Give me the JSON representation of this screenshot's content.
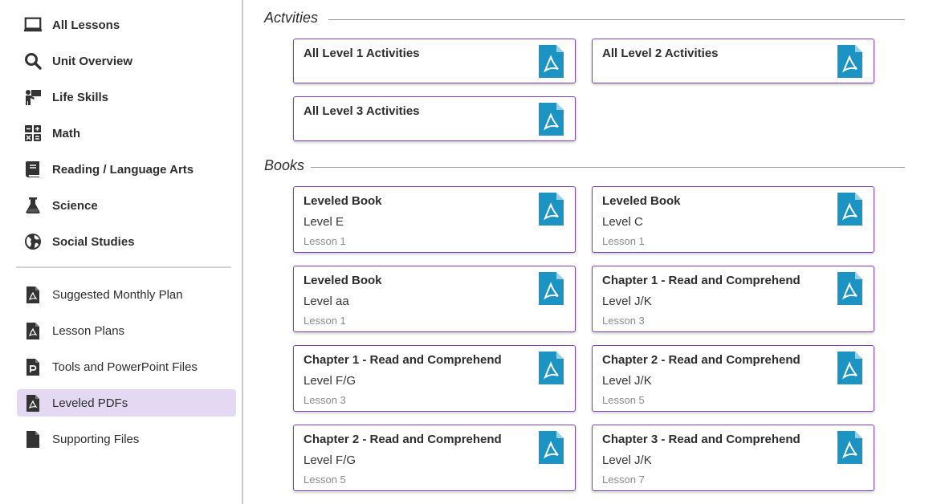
{
  "sidebar": {
    "items": [
      {
        "label": "All Lessons"
      },
      {
        "label": "Unit Overview"
      },
      {
        "label": "Life Skills"
      },
      {
        "label": "Math"
      },
      {
        "label": "Reading / Language Arts"
      },
      {
        "label": "Science"
      },
      {
        "label": "Social Studies"
      }
    ],
    "resources": [
      {
        "label": "Suggested Monthly Plan"
      },
      {
        "label": "Lesson Plans"
      },
      {
        "label": "Tools and PowerPoint Files"
      },
      {
        "label": "Leveled PDFs"
      },
      {
        "label": "Supporting Files"
      }
    ],
    "active_item": "Leveled PDFs",
    "active_color": "#e4d9f3"
  },
  "sections": {
    "activities": {
      "title": "Actvities",
      "cards": [
        {
          "title": "All Level 1 Activities"
        },
        {
          "title": "All Level 2 Activities"
        },
        {
          "title": "All Level 3 Activities"
        }
      ]
    },
    "books": {
      "title": "Books",
      "cards": [
        {
          "title": "Leveled Book",
          "level": "Level E",
          "lesson": "Lesson 1"
        },
        {
          "title": "Leveled Book",
          "level": "Level C",
          "lesson": "Lesson 1"
        },
        {
          "title": "Leveled Book",
          "level": "Level aa",
          "lesson": "Lesson 1"
        },
        {
          "title": "Chapter 1 - Read and Comprehend",
          "level": "Level J/K",
          "lesson": "Lesson 3"
        },
        {
          "title": "Chapter 1 - Read and Comprehend",
          "level": "Level F/G",
          "lesson": "Lesson 3"
        },
        {
          "title": "Chapter 2 - Read and Comprehend",
          "level": "Level J/K",
          "lesson": "Lesson 5"
        },
        {
          "title": "Chapter 2 - Read and Comprehend",
          "level": "Level F/G",
          "lesson": "Lesson 5"
        },
        {
          "title": "Chapter 3 - Read and Comprehend",
          "level": "Level J/K",
          "lesson": "Lesson 7"
        }
      ]
    }
  },
  "icons": {
    "pdf": "pdf-file-icon",
    "pdf_color": "#1b94c4",
    "card_border": "#7b3fc0"
  }
}
